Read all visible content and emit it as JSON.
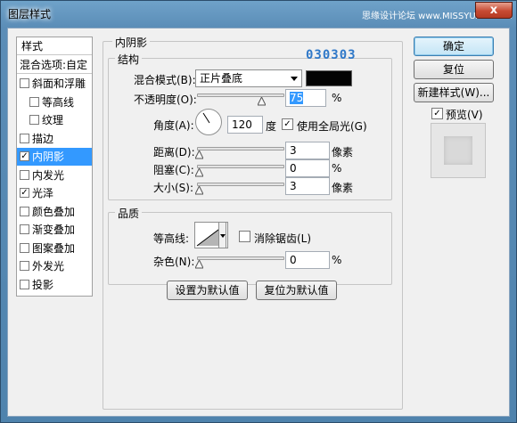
{
  "window": {
    "title": "图层样式",
    "watermark": "思缘设计论坛 www.MISSYUAN.COM",
    "close_label": "x"
  },
  "left_list": {
    "header_label": "样式",
    "blend_options_label": "混合选项:自定",
    "items": [
      {
        "label": "斜面和浮雕",
        "checked": false
      },
      {
        "label": "等高线",
        "checked": false
      },
      {
        "label": "纹理",
        "checked": false
      },
      {
        "label": "描边",
        "checked": false
      },
      {
        "label": "内阴影",
        "checked": true,
        "selected": true
      },
      {
        "label": "内发光",
        "checked": false
      },
      {
        "label": "光泽",
        "checked": true
      },
      {
        "label": "颜色叠加",
        "checked": false
      },
      {
        "label": "渐变叠加",
        "checked": false
      },
      {
        "label": "图案叠加",
        "checked": false
      },
      {
        "label": "外发光",
        "checked": false
      },
      {
        "label": "投影",
        "checked": false
      }
    ]
  },
  "inner_shadow": {
    "section_title": "内阴影",
    "structure_title": "结构",
    "color_annotation": "030303",
    "blend_mode_label": "混合模式(B):",
    "blend_mode_value": "正片叠底",
    "shadow_color": "#030303",
    "opacity_label": "不透明度(O):",
    "opacity_value": "75",
    "opacity_unit": "%",
    "angle_label": "角度(A):",
    "angle_value": "120",
    "angle_unit": "度",
    "global_light_label": "使用全局光(G)",
    "global_light_checked": true,
    "distance_label": "距离(D):",
    "distance_value": "3",
    "distance_unit": "像素",
    "choke_label": "阻塞(C):",
    "choke_value": "0",
    "choke_unit": "%",
    "size_label": "大小(S):",
    "size_value": "3",
    "size_unit": "像素"
  },
  "quality": {
    "title": "品质",
    "contour_label": "等高线:",
    "anti_alias_label": "消除锯齿(L)",
    "anti_alias_checked": false,
    "noise_label": "杂色(N):",
    "noise_value": "0",
    "noise_unit": "%"
  },
  "buttons": {
    "set_default": "设置为默认值",
    "reset_default": "复位为默认值",
    "ok": "确定",
    "reset": "复位",
    "new_style": "新建样式(W)...",
    "preview_label": "预览(V)",
    "preview_checked": true
  }
}
